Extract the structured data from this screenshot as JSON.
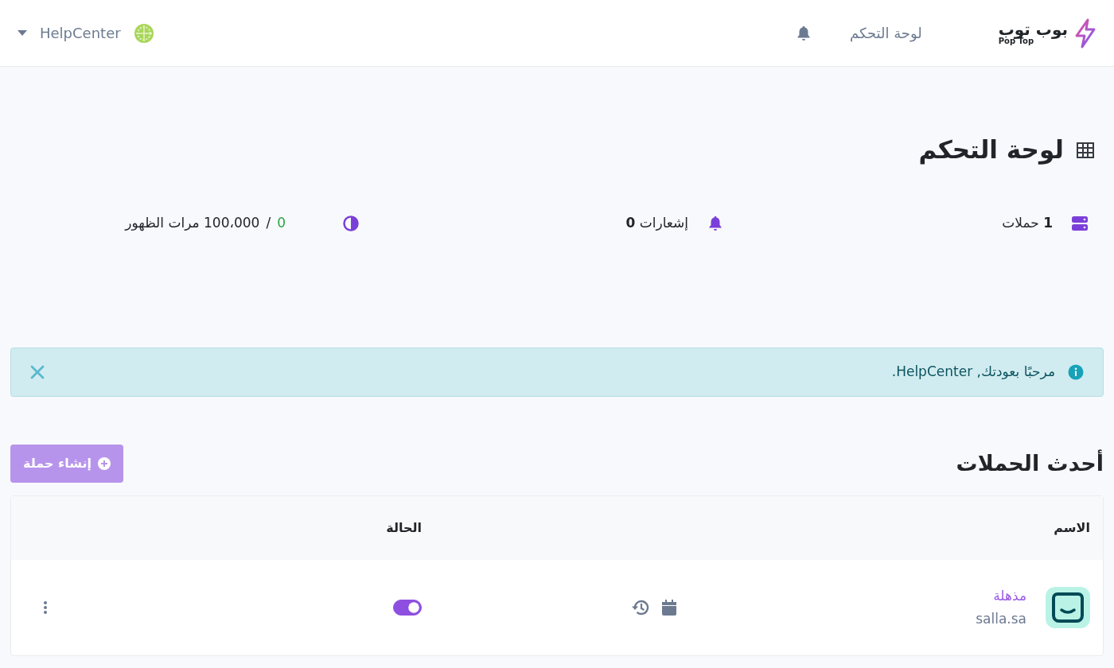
{
  "brand": {
    "name": "بوب توب",
    "tagline": "Pop Top"
  },
  "nav": [
    {
      "label": "لوحة التحكم"
    }
  ],
  "user": {
    "name": "HelpCenter"
  },
  "page_title": "لوحة التحكم",
  "stats": [
    {
      "kind": "campaigns",
      "text": "**1** حملات"
    },
    {
      "kind": "notifications",
      "text": "إشعارات **0**"
    },
    {
      "kind": "views",
      "used": "0",
      "separator": "/",
      "text": "100،000 مرات الظهور"
    }
  ],
  "alert": {
    "text": "مرحبًا بعودتك, HelpCenter."
  },
  "section_title": "أحدث الحملات",
  "create_button": "إنشاء حملة",
  "table": {
    "columns": [
      "الاسم",
      "الحالة"
    ],
    "rows": [
      {
        "name": "مذهلة",
        "site": "salla.sa",
        "on": true
      }
    ]
  }
}
